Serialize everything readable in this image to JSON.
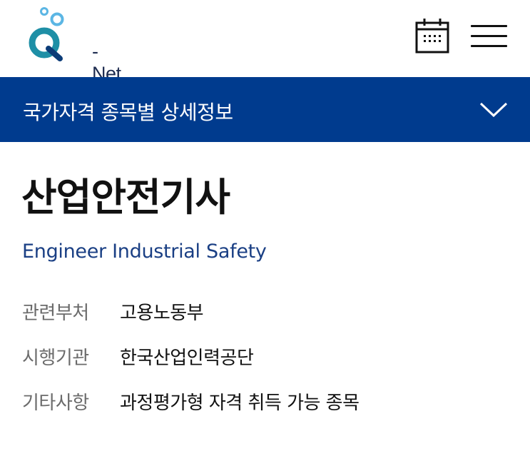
{
  "header": {
    "logo_text": "- Net",
    "logo_letter": "Q",
    "calendar_icon": "calendar-icon",
    "menu_icon": "hamburger-menu-icon"
  },
  "banner": {
    "title": "국가자격 종목별 상세정보",
    "toggle_icon": "chevron-down-icon"
  },
  "qualification": {
    "name_ko": "산업안전기사",
    "name_en": "Engineer Industrial Safety"
  },
  "info": [
    {
      "label": "관련부처",
      "value": "고용노동부"
    },
    {
      "label": "시행기관",
      "value": "한국산업인력공단"
    },
    {
      "label": "기타사항",
      "value": "과정평가형 자격 취득 가능 종목"
    }
  ],
  "colors": {
    "banner_bg": "#003b8e",
    "subtitle": "#1a3f84",
    "logo_teal": "#1e8fa6",
    "logo_light_blue": "#5bb6e4"
  }
}
